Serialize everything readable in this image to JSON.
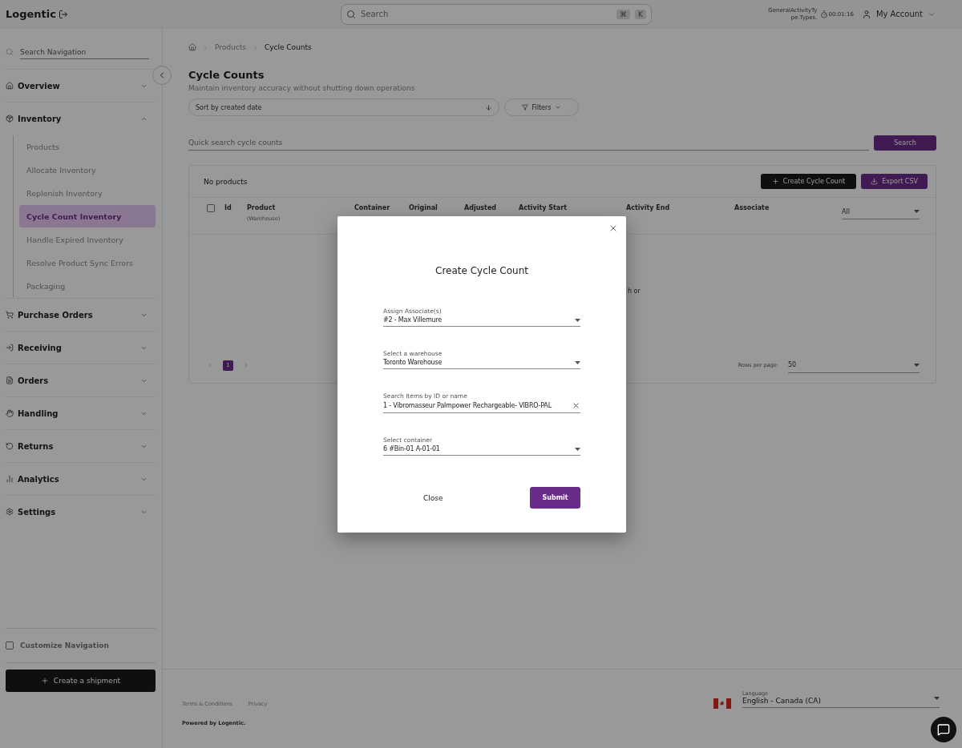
{
  "header": {
    "logo": "Logentic",
    "search": {
      "placeholder": "Search",
      "shortcut": [
        "⌘",
        "K"
      ]
    },
    "activity": "GeneralActivityType.Types.",
    "timer": "00:01:16",
    "account": "My Account"
  },
  "sidebar": {
    "search": {
      "placeholder": "Search Navigation"
    },
    "items": [
      {
        "label": "Overview",
        "expanded": false
      },
      {
        "label": "Inventory",
        "expanded": true,
        "children": [
          {
            "label": "Products",
            "selected": false
          },
          {
            "label": "Allocate Inventory",
            "selected": false
          },
          {
            "label": "Replenish Inventory",
            "selected": false
          },
          {
            "label": "Cycle Count Inventory",
            "selected": true
          },
          {
            "label": "Handle Expired Inventory",
            "selected": false
          },
          {
            "label": "Resolve Product Sync Errors",
            "selected": false
          },
          {
            "label": "Packaging",
            "selected": false
          }
        ]
      },
      {
        "label": "Purchase Orders",
        "expanded": false
      },
      {
        "label": "Receiving",
        "expanded": false
      },
      {
        "label": "Orders",
        "expanded": false
      },
      {
        "label": "Handling",
        "expanded": false
      },
      {
        "label": "Returns",
        "expanded": false
      },
      {
        "label": "Analytics",
        "expanded": false
      },
      {
        "label": "Settings",
        "expanded": false
      }
    ],
    "customize": {
      "label": "Customize Navigation",
      "checked": false
    },
    "create_button": "Create a shipment"
  },
  "breadcrumb": [
    "Products",
    "Cycle Counts"
  ],
  "page": {
    "title": "Cycle Counts",
    "subtitle": "Maintain inventory accuracy without shutting down operations",
    "sort": "Sort by created date",
    "filters": "Filters",
    "quick_search": {
      "placeholder": "Quick search cycle counts"
    },
    "search_button": "Search"
  },
  "table": {
    "summary": "No products",
    "select_all_checked": false,
    "create_button": "Create Cycle Count",
    "export_button": "Export CSV",
    "columns": [
      {
        "label": "Id"
      },
      {
        "label": "Product",
        "sub": "(Warehouse)"
      },
      {
        "label": "Container"
      },
      {
        "label": "Original"
      },
      {
        "label": "Adjusted"
      },
      {
        "label": "Activity Start"
      },
      {
        "label": "Activity End"
      },
      {
        "label": "Associate"
      }
    ],
    "filter_select": "All",
    "empty_fragment": "h or",
    "pages": [
      {
        "label": "1",
        "selected": true
      }
    ],
    "rows_per_page_label": "Rows per page:",
    "rows_per_page": "50"
  },
  "footer": {
    "links": [
      "Terms & Conditions",
      "Privacy"
    ],
    "powered": "Powered by Logentic.",
    "language_label": "Language",
    "language": "English - Canada (CA)"
  },
  "modal": {
    "title": "Create Cycle Count",
    "fields": [
      {
        "kind": "select",
        "label": "Assign Associate(s)",
        "value": "#2 - Max Villemure"
      },
      {
        "kind": "select",
        "label": "Select a warehouse",
        "value": "Toronto Warehouse"
      },
      {
        "kind": "search",
        "label": "Search Items by ID or name",
        "value": "1 - Vibromasseur Palmpower Rechargeable- VIBRO-PAL"
      },
      {
        "kind": "select",
        "label": "Select container",
        "value": "6 #Bin-01 A-01-01"
      }
    ],
    "close": "Close",
    "submit": "Submit"
  }
}
